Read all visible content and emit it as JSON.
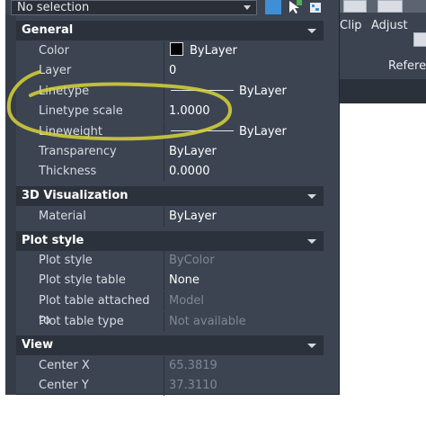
{
  "selection": {
    "value": "No selection"
  },
  "ribbon": {
    "clip_label": "Clip",
    "adjust_label": "Adjust",
    "reference_label": "Referen"
  },
  "sections": {
    "general": {
      "title": "General"
    },
    "viz3d": {
      "title": "3D Visualization"
    },
    "plot": {
      "title": "Plot style"
    },
    "view": {
      "title": "View"
    }
  },
  "rows": {
    "color": {
      "label": "Color",
      "value": "ByLayer",
      "swatch": "#000000"
    },
    "layer": {
      "label": "Layer",
      "value": "0"
    },
    "linetype": {
      "label": "Linetype",
      "value": "ByLayer"
    },
    "linetype_scale": {
      "label": "Linetype scale",
      "value": "1.0000"
    },
    "lineweight": {
      "label": "Lineweight",
      "value": "ByLayer"
    },
    "transparency": {
      "label": "Transparency",
      "value": "ByLayer"
    },
    "thickness": {
      "label": "Thickness",
      "value": "0.0000"
    },
    "material": {
      "label": "Material",
      "value": "ByLayer"
    },
    "plot_style": {
      "label": "Plot style",
      "value": "ByColor"
    },
    "plot_style_table": {
      "label": "Plot style table",
      "value": "None"
    },
    "plot_table_attached": {
      "label": "Plot table attached to",
      "value": "Model"
    },
    "plot_table_type": {
      "label": "Plot table type",
      "value": "Not available"
    },
    "center_x": {
      "label": "Center X",
      "value": "65.3819"
    },
    "center_y": {
      "label": "Center Y",
      "value": "37.3110"
    }
  },
  "colors": {
    "panel": "#3c4452",
    "header": "#2c323b",
    "highlight": "#d8d43a"
  }
}
